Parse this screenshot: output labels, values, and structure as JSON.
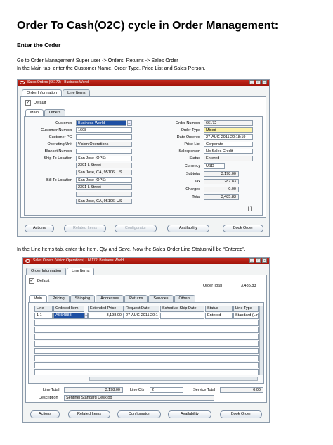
{
  "title": "Order To Cash(O2C) cycle in Order Management:",
  "subtitle": "Enter the Order",
  "para1": "Go to Order Management Super user -> Orders, Returns -> Sales Order",
  "para2": "In the Main tab, enter the Customer Name, Order Type, Price List and Sales Person.",
  "para3": "In the Line Items tab, enter the Item, Qty and Save. Now the Sales Order Line Status will be “Entered”.",
  "form1": {
    "title": "Sales Orders (66172) - Business World",
    "outer_tabs": [
      "Order Information",
      "Line Items"
    ],
    "default_label": "Default",
    "inner_tabs": [
      "Main",
      "Others"
    ],
    "left_fields": [
      {
        "label": "Customer",
        "value": "Business World"
      },
      {
        "label": "Customer Number",
        "value": "1608"
      },
      {
        "label": "Customer PO",
        "value": ""
      },
      {
        "label": "Operating Unit",
        "value": "Vision Operations"
      },
      {
        "label": "Blanket Number",
        "value": ""
      },
      {
        "label": "Ship To Location",
        "value": "San Jose (OPS)"
      }
    ],
    "ship_addr": [
      "2391 L Street",
      "San Jose, CA, 95106, US"
    ],
    "bill_label": "Bill To Location",
    "bill_values": [
      "San Jose (OPS)",
      "2391 L Street",
      "",
      "San Jose, CA, 95106, US"
    ],
    "right_fields": [
      {
        "label": "Order Number",
        "value": "66172"
      },
      {
        "label": "Order Type",
        "value": "Mixed"
      },
      {
        "label": "Date Ordered",
        "value": "27-AUG-2011 20:18:19"
      },
      {
        "label": "Price List",
        "value": "Corporate"
      },
      {
        "label": "Salesperson",
        "value": "No Sales Credit"
      },
      {
        "label": "Status",
        "value": "Entered"
      },
      {
        "label": "Currency",
        "value": "USD"
      },
      {
        "label": "Subtotal",
        "value": "3,198.00"
      },
      {
        "label": "Tax",
        "value": "287.83"
      },
      {
        "label": "Charges",
        "value": "0.00"
      },
      {
        "label": "Total",
        "value": "3,485.83"
      }
    ],
    "indicator": "[ ]",
    "buttons": [
      "Actions",
      "Related Items",
      "Configurator",
      "Availability",
      "Book Order"
    ]
  },
  "form2": {
    "title": "Sales Orders (Vision Operations) - 66172, Business World",
    "outer_tabs": [
      "Order Information",
      "Line Items"
    ],
    "default_label": "Default",
    "order_total_label": "Order Total",
    "order_total": "3,485.83",
    "inner_tabs": [
      "Main",
      "Pricing",
      "Shipping",
      "Addresses",
      "Returns",
      "Services",
      "Others"
    ],
    "columns": [
      "Line",
      "Ordered Item",
      "Extended Price",
      "Request Date",
      "Schedule Ship Date",
      "Status",
      "Line Type"
    ],
    "row": {
      "line": "1.1",
      "item": "AS54888",
      "price": "3,198.00",
      "request_date": "27-AUG-2011 20:1",
      "ship_date": "",
      "status": "Entered",
      "line_type": "Standard (Line"
    },
    "line_total_label": "Line Total",
    "line_total": "3,198.00",
    "line_qty_label": "Line Qty",
    "line_qty": "2",
    "service_total_label": "Service Total",
    "service_total": "0.00",
    "description_label": "Description",
    "description": "Sentinel Standard Desktop",
    "buttons": [
      "Actions",
      "Related Items",
      "Configurator",
      "Availability",
      "Book Order"
    ]
  }
}
